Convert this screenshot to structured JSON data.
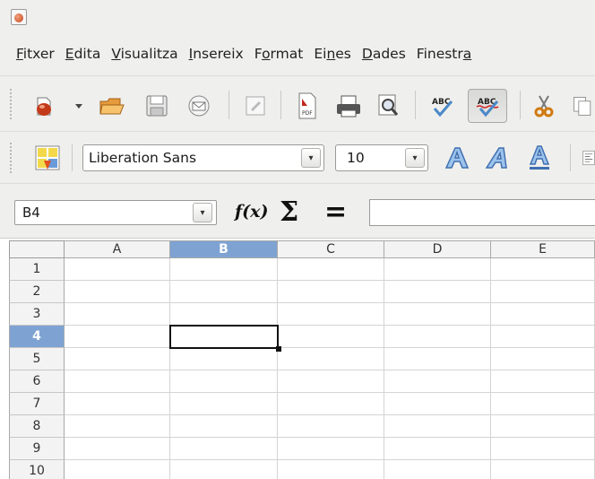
{
  "window": {
    "app_icon": "calc-app-icon"
  },
  "menu": {
    "items": [
      {
        "pre": "",
        "acc": "F",
        "post": "itxer"
      },
      {
        "pre": "",
        "acc": "E",
        "post": "dita"
      },
      {
        "pre": "",
        "acc": "V",
        "post": "isualitza"
      },
      {
        "pre": "",
        "acc": "I",
        "post": "nsereix"
      },
      {
        "pre": "F",
        "acc": "o",
        "post": "rmat"
      },
      {
        "pre": "Ei",
        "acc": "n",
        "post": "es"
      },
      {
        "pre": "",
        "acc": "D",
        "post": "ades"
      },
      {
        "pre": "Finestr",
        "acc": "a",
        "post": ""
      }
    ]
  },
  "toolbar": {
    "icons": [
      "new-document-icon",
      "new-dropdown-arrow-icon",
      "open-folder-icon",
      "save-icon",
      "email-icon",
      "edit-file-icon",
      "export-pdf-icon",
      "print-icon",
      "print-preview-icon",
      "spellcheck-icon",
      "autospellcheck-icon",
      "cut-icon",
      "copy-icon"
    ],
    "pdf_label": "PDF",
    "abc_label": "ABC"
  },
  "formatting": {
    "font_name": "Liberation Sans",
    "font_size": "10",
    "icons": [
      "styles-icon",
      "bold-icon",
      "italic-icon",
      "underline-icon",
      "align-left-icon"
    ]
  },
  "formula": {
    "name_box": "B4",
    "fx_label": "f(x)",
    "sum_label": "Σ",
    "equals_label": "=",
    "value": ""
  },
  "grid": {
    "columns": [
      "A",
      "B",
      "C",
      "D",
      "E"
    ],
    "rows": [
      "1",
      "2",
      "3",
      "4",
      "5",
      "6",
      "7",
      "8",
      "9",
      "10"
    ],
    "active_column": "B",
    "active_row": "4",
    "active_cell": "B4"
  },
  "colors": {
    "header_active": "#7ea3d3",
    "chrome_bg": "#efefed",
    "grid_line": "#d4d4d4"
  }
}
